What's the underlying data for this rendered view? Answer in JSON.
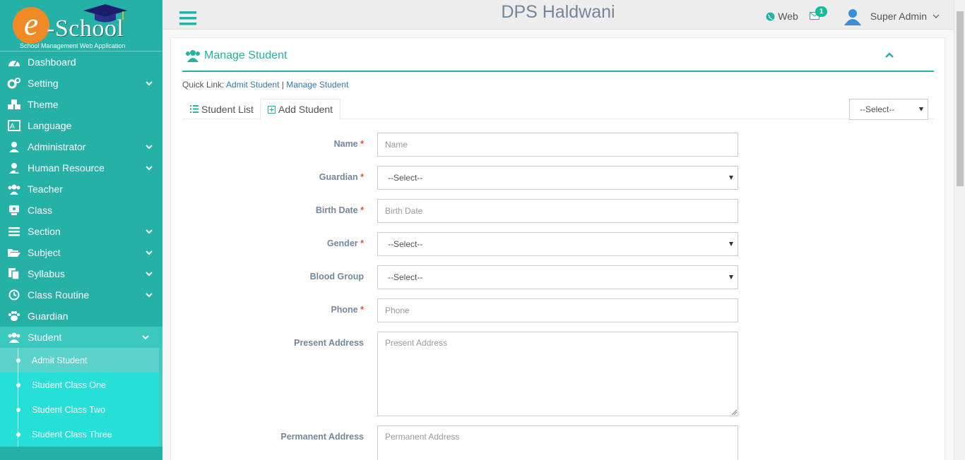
{
  "logo": {
    "letter": "e",
    "name": "-School",
    "subtitle": "School Management Web Application"
  },
  "topbar": {
    "brand": "DPS Haldwani",
    "web_label": "Web",
    "message_count": "1",
    "user_name": "Super Admin"
  },
  "sidebar": {
    "items": [
      {
        "label": "Dashboard",
        "icon": "dashboard-icon",
        "has_sub": false
      },
      {
        "label": "Setting",
        "icon": "gears-icon",
        "has_sub": true
      },
      {
        "label": "Theme",
        "icon": "cubes-icon",
        "has_sub": false
      },
      {
        "label": "Language",
        "icon": "language-icon",
        "has_sub": false
      },
      {
        "label": "Administrator",
        "icon": "user-icon",
        "has_sub": true
      },
      {
        "label": "Human Resource",
        "icon": "user-md-icon",
        "has_sub": true
      },
      {
        "label": "Teacher",
        "icon": "users-icon",
        "has_sub": false
      },
      {
        "label": "Class",
        "icon": "classroom-icon",
        "has_sub": false
      },
      {
        "label": "Section",
        "icon": "bars-icon",
        "has_sub": true
      },
      {
        "label": "Subject",
        "icon": "folder-open-icon",
        "has_sub": true
      },
      {
        "label": "Syllabus",
        "icon": "copy-icon",
        "has_sub": true
      },
      {
        "label": "Class Routine",
        "icon": "clock-icon",
        "has_sub": true
      },
      {
        "label": "Guardian",
        "icon": "paw-icon",
        "has_sub": false
      },
      {
        "label": "Student",
        "icon": "group-icon",
        "has_sub": true
      }
    ],
    "student_sub": [
      "Admit Student",
      "Student Class One",
      "Student Class Two",
      "Student Class Three"
    ]
  },
  "panel": {
    "title": "Manage Student",
    "quicklink_prefix": "Quick Link:",
    "quicklinks": [
      "Admit Student",
      "Manage Student"
    ],
    "quicklink_sep": "|",
    "tabs": [
      "Student List",
      "Add Student"
    ],
    "tab_select": "--Select--"
  },
  "form": {
    "name": {
      "label": "Name",
      "placeholder": "Name"
    },
    "guardian": {
      "label": "Guardian",
      "value": "--Select--"
    },
    "birth_date": {
      "label": "Birth Date",
      "placeholder": "Birth Date"
    },
    "gender": {
      "label": "Gender",
      "value": "--Select--"
    },
    "blood_group": {
      "label": "Blood Group",
      "value": "--Select--"
    },
    "phone": {
      "label": "Phone",
      "placeholder": "Phone"
    },
    "present_address": {
      "label": "Present Address",
      "placeholder": "Present Address"
    },
    "permanent_address": {
      "label": "Permanent Address",
      "placeholder": "Permanent Address"
    },
    "required_mark": "*"
  },
  "colors": {
    "sidebar": "#26b1a6",
    "submenu": "#26e0d8",
    "accent": "#26b1a6",
    "required": "#e74c3c",
    "badge": "#1abb9c"
  }
}
